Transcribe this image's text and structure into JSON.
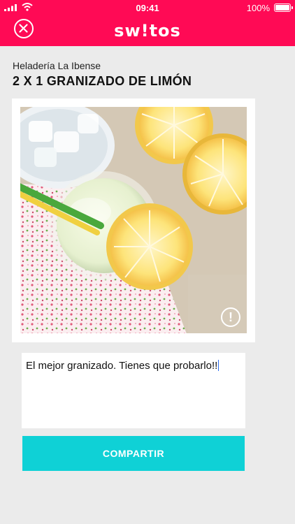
{
  "status_bar": {
    "time": "09:41",
    "battery": "100%"
  },
  "header": {
    "logo": "sw!tos"
  },
  "offer": {
    "shop_name": "Heladería La Ibense",
    "title": "2 X 1 GRANIZADO DE LIMÓN"
  },
  "comment": {
    "value": "El mejor granizado. Tienes que probarlo!!"
  },
  "share": {
    "label": "COMPARTIR"
  },
  "icons": [
    "signal-icon",
    "wifi-icon",
    "battery-icon",
    "close-icon",
    "report-icon"
  ],
  "colors": {
    "brand": "#ff0a55",
    "share_button": "#0fd1d6",
    "background": "#ebebeb"
  }
}
